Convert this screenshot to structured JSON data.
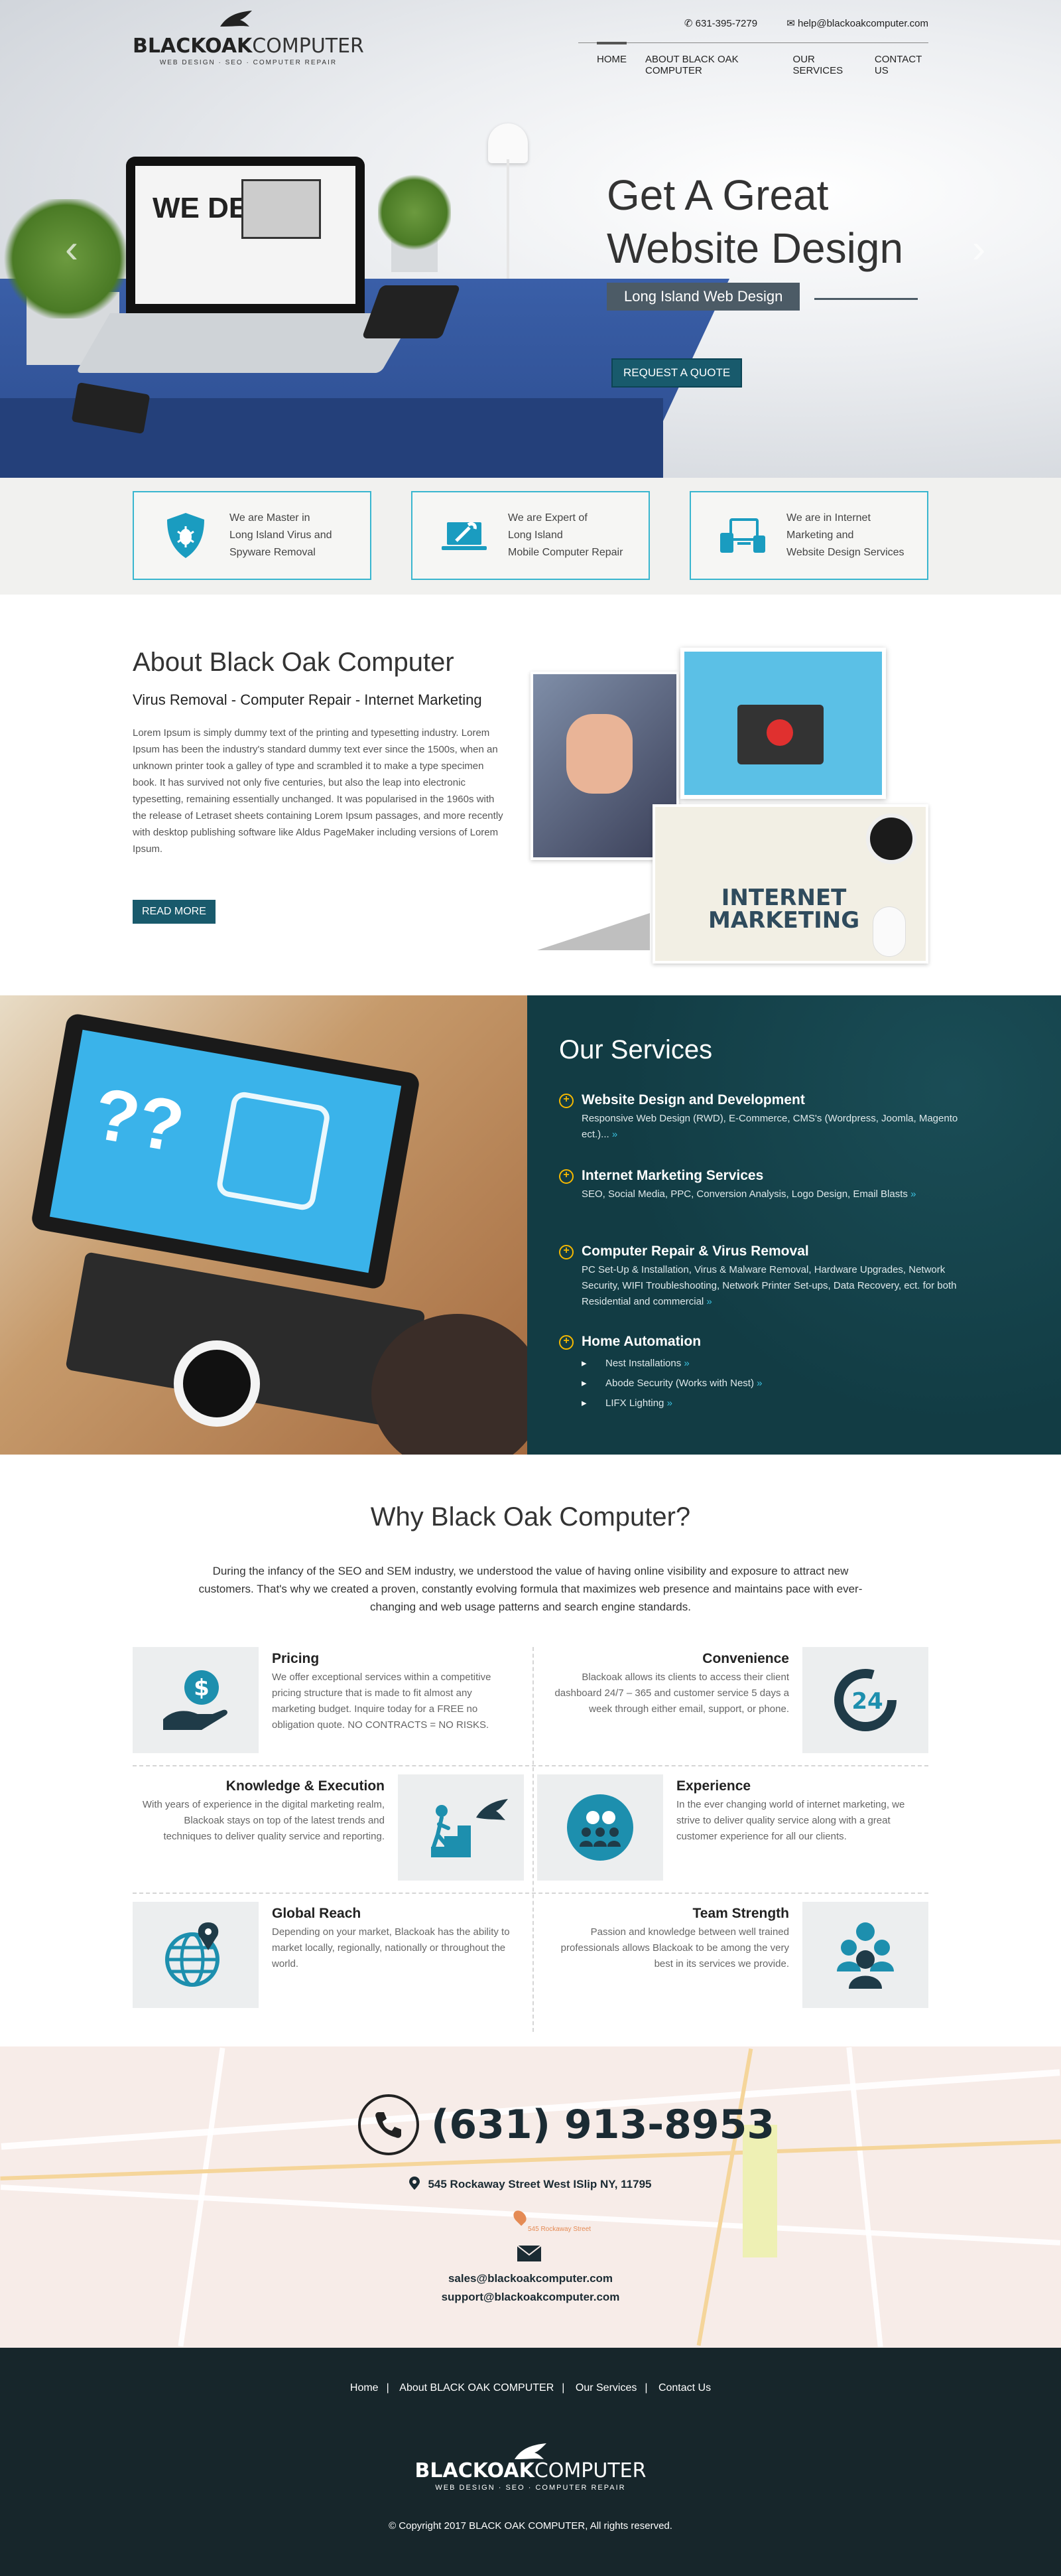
{
  "header": {
    "brand_bold": "BLACKOAK",
    "brand_light": "COMPUTER",
    "tagline": "WEB DESIGN · SEO · COMPUTER REPAIR",
    "phone": "631-395-7279",
    "email": "help@blackoakcomputer.com",
    "nav": [
      {
        "label": "HOME",
        "active": true
      },
      {
        "label": "ABOUT BLACK OAK COMPUTER"
      },
      {
        "label": "OUR SERVICES"
      },
      {
        "label": "CONTACT US"
      }
    ]
  },
  "hero": {
    "title_line1": "Get A Great",
    "title_line2": "Website Design",
    "subtitle": "Long Island Web Design",
    "cta": "REQUEST A QUOTE",
    "screen_text": "WE DESIGN",
    "prev_arrow": "‹",
    "next_arrow": "›"
  },
  "features": [
    {
      "icon": "shield-bug-icon",
      "text": "We are Master in\nLong Island Virus and\nSpyware Removal"
    },
    {
      "icon": "laptop-wrench-icon",
      "text": "We are Expert of\nLong Island\nMobile Computer Repair"
    },
    {
      "icon": "devices-icon",
      "text": "We are in Internet\nMarketing and\nWebsite Design Services"
    }
  ],
  "about": {
    "title": "About Black Oak Computer",
    "subtitle": "Virus Removal - Computer Repair - Internet Marketing",
    "body": "Lorem Ipsum is simply dummy text of the printing and typesetting industry. Lorem Ipsum has been the industry's standard dummy text ever since the 1500s, when an unknown printer took a galley of type and scrambled it to make a type specimen book. It has survived not only five centuries, but also the leap into electronic typesetting, remaining essentially unchanged. It was popularised in the 1960s with the release of Letraset sheets containing Lorem Ipsum passages, and more recently with desktop publishing software like Aldus PageMaker including versions of Lorem Ipsum.",
    "button": "READ MORE",
    "collage_text_1": "INTERNET",
    "collage_text_2": "MARKETING"
  },
  "services": {
    "title": "Our Services",
    "items": [
      {
        "title": "Website Design and Development",
        "desc": "Responsive Web Design (RWD), E-Commerce, CMS's (Wordpress, Joomla, Magento ect.)..."
      },
      {
        "title": "Internet Marketing Services",
        "desc": "SEO, Social Media, PPC, Conversion Analysis, Logo Design, Email Blasts"
      },
      {
        "title": "Computer Repair & Virus Removal",
        "desc": "PC Set-Up & Installation, Virus & Malware Removal, Hardware Upgrades, Network Security, WIFI Troubleshooting, Network Printer Set-ups, Data Recovery, ect. for both Residential and commercial"
      },
      {
        "title": "Home Automation",
        "list": [
          "Nest Installations",
          "Abode Security (Works with Nest)",
          "LIFX Lighting"
        ]
      }
    ],
    "more_glyph": "»"
  },
  "why": {
    "title": "Why Black Oak Computer?",
    "intro": "During the infancy of the SEO and SEM industry, we understood the value of having online visibility and exposure to attract new customers. That's why we created a proven, constantly evolving formula that maximizes web presence and maintains pace with ever-changing and web usage patterns and search engine standards.",
    "items": [
      {
        "title": "Pricing",
        "desc": "We offer exceptional services within a competitive pricing structure that is made to fit almost any marketing budget. Inquire today for a FREE no obligation quote. NO CONTRACTS = NO RISKS.",
        "icon": "hand-dollar-icon"
      },
      {
        "title": "Convenience",
        "desc": "Blackoak allows its clients to access their client dashboard 24/7 – 365 and customer service 5 days a week through either email, support, or phone.",
        "icon": "clock-24-icon",
        "badge": "24"
      },
      {
        "title": "Knowledge & Execution",
        "desc": "With years of experience in the digital marketing realm, Blackoak stays on top of the latest trends and techniques to deliver quality service and reporting.",
        "icon": "stairs-climber-icon"
      },
      {
        "title": "Experience",
        "desc": "In the ever changing world of internet marketing, we strive to deliver quality service along with a great customer experience for all our clients.",
        "icon": "social-people-icon"
      },
      {
        "title": "Global Reach",
        "desc": "Depending on your market, Blackoak has the ability to market locally, regionally, nationally or throughout the world.",
        "icon": "globe-pin-icon"
      },
      {
        "title": "Team Strength",
        "desc": "Passion and knowledge between well trained professionals allows Blackoak to be among the very best in its services we provide.",
        "icon": "team-icon"
      }
    ]
  },
  "contact": {
    "phone": "(631) 913-8953",
    "address": "545 Rockaway Street West ISlip NY, 11795",
    "map_marker_label": "545 Rockaway Street",
    "email_sales": "sales@blackoakcomputer.com",
    "email_support": "support@blackoakcomputer.com"
  },
  "footer": {
    "links": [
      "Home",
      "About BLACK OAK COMPUTER",
      "Our Services",
      "Contact Us"
    ],
    "separator": "|",
    "brand_bold": "BLACKOAK",
    "brand_light": "COMPUTER",
    "tagline": "WEB DESIGN · SEO · COMPUTER REPAIR",
    "copyright": "© Copyright 2017 BLACK OAK COMPUTER, All rights reserved."
  },
  "colors": {
    "accent": "#39b6cf",
    "button": "#195a6c",
    "services_bg": "#123c44",
    "footer_bg": "#17262b",
    "bullet": "#f5b800"
  }
}
